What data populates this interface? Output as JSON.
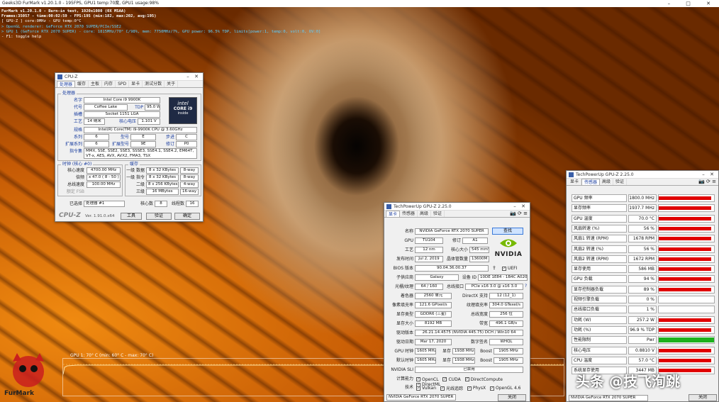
{
  "furmark": {
    "window_title": "Geeks3D FurMark v1.20.1.0 - 195FPS, GPU1 temp:70度, GPU1 usage:98%",
    "osd_lines": [
      "FurMark v1.20.1.0 - Burn-in test, 1920x1080 (0X MSAA)",
      "Frames:35057 - time:00:02:59 - FPS:195 (min:182, max:202, avg:195)",
      "[ GPU-Z ] core:0MHz - GPU temp:0°C",
      "> OpenGL renderer: GeForce RTX 2070 SUPER/PCIe/SSE2",
      "> GPU 1 (GeForce RTX 2070 SUPER) - core: 1815MHz/70° C/98%, mem: 7750MHz/7%, GPU power: 96.5% TDP, limits[power:1, temp:0, volt:0, OV:0]",
      "- F1: toggle help"
    ],
    "graph_label": "GPU 1: 70° C (min: 60° C - max: 70° C)",
    "logo_text": "FurMark"
  },
  "cpuz": {
    "title": "CPU-Z",
    "tabs": [
      "处理器",
      "缓存",
      "主板",
      "内存",
      "SPD",
      "显卡",
      "测试分数",
      "关于"
    ],
    "processor_group": "处理器",
    "labels": {
      "name": "名字",
      "code": "代号",
      "tdp": "TDP",
      "package": "插槽",
      "tech": "工艺",
      "vcore": "核心电压",
      "spec": "规格",
      "family": "系列",
      "model": "型号",
      "stepping": "步进",
      "ext_family": "扩展系列",
      "ext_model": "扩展型号",
      "revision": "修订",
      "instr": "指令集"
    },
    "values": {
      "name": "Intel Core i9 9900K",
      "code": "Coffee Lake",
      "tdp": "95.0 W",
      "package": "Socket 1151 LGA",
      "tech": "14 纳米",
      "vcore": "1.101 V",
      "spec": "Intel(R) Core(TM) i9-9900K CPU @ 3.60GHz",
      "family": "6",
      "model": "E",
      "stepping": "C",
      "ext_family": "6",
      "ext_model": "9E",
      "revision": "P0",
      "instr": "MMX, SSE, SSE2, SSE3, SSSE3, SSE4.1, SSE4.2, EM64T, VT-x, AES, AVX, AVX2, FMA3, TSX"
    },
    "logo": {
      "brand": "intel",
      "line1": "CORE i9",
      "line2": "inside"
    },
    "clocks_group": "时钟 (核心 #0)",
    "clock_labels": [
      "核心速度",
      "倍频",
      "总线速度",
      "额定 FSB"
    ],
    "clock_values": [
      "4700.00 MHz",
      "x 47.0 ( 8 - 50 )",
      "100.00 MHz",
      ""
    ],
    "cache_group": "缓存",
    "cache_rows": [
      [
        "一级 数据",
        "8 x 32 KBytes",
        "8-way"
      ],
      [
        "一级 指令",
        "8 x 32 KBytes",
        "8-way"
      ],
      [
        "二级",
        "8 x 256 KBytes",
        "4-way"
      ],
      [
        "三级",
        "16 MBytes",
        "16-way"
      ]
    ],
    "selected_label": "已选择",
    "selected_value": "处理器 #1",
    "cores_label": "核心数",
    "cores_value": "8",
    "threads_label": "线程数",
    "threads_value": "16",
    "footer_brand": "CPU-Z",
    "version": "Ver. 1.91.0.x64",
    "tools_btn": "工具",
    "validate_btn": "验证",
    "ok_btn": "确定"
  },
  "gpuz": {
    "title": "TechPowerUp GPU-Z 2.25.0",
    "tabs": [
      "显卡",
      "传感器",
      "高级",
      "验证"
    ],
    "lookup_btn": "查找",
    "labels": {
      "name": "名称",
      "gpu": "GPU",
      "rev": "修订",
      "tech": "工艺",
      "die": "核心大小",
      "release": "发布时间",
      "transistors": "晶体管数量",
      "bios": "BIOS 版本",
      "subvendor": "子供应商",
      "device_id": "设备 ID",
      "rops": "光栅/纹理",
      "bus": "总线接口",
      "shaders": "着色器",
      "dx": "DirectX 支持",
      "pixel": "像素填充率",
      "texture": "纹理填充率",
      "memtype": "显存类型",
      "buswidth": "总线宽度",
      "memsize": "显存大小",
      "bandwidth": "带宽",
      "driver": "驱动版本",
      "driverdate": "驱动日期",
      "sig": "数字签名",
      "gpuclock": "GPU 时钟",
      "memory": "显存",
      "boost": "Boost",
      "defclock": "默认时钟",
      "sli": "NVIDIA SLI",
      "compute": "计算能力",
      "tech2": "技术"
    },
    "values": {
      "name": "NVIDIA GeForce RTX 2070 SUPER",
      "gpu": "TU104",
      "rev": "A1",
      "tech": "12 nm",
      "die": "545 mm²",
      "release": "Jul 2, 2019",
      "transistors": "13600M",
      "bios": "90.04.36.00.37",
      "uefi": "UEFI",
      "subvendor": "Galaxy",
      "device_id": "10DE 1E84 - 1B4C A020",
      "rops": "64 / 160",
      "bus": "PCIe x16 3.0 @ x16 3.0",
      "shaders": "2560 单元",
      "dx": "12 (12_1)",
      "pixel": "121.6 GPixel/s",
      "texture": "304.0 GTexel/s",
      "memtype": "GDDR6 (三星)",
      "buswidth": "256 位",
      "memsize": "8192 MB",
      "bandwidth": "496.1 GB/s",
      "driver": "26.21.14.4575 (NVIDIA 445.75) DCH / Win10 64",
      "driverdate": "Mar 17, 2020",
      "sig": "WHQL",
      "gpuclock": "1605 MHz",
      "memory1": "1938 MHz",
      "boost1": "1905 MHz",
      "defclock": "1605 MHz",
      "memory2": "1938 MHz",
      "boost2": "1905 MHz",
      "sli": "已禁用"
    },
    "compute": [
      "OpenCL",
      "CUDA",
      "DirectCompute",
      "DirectML"
    ],
    "tech2": [
      "Vulkan",
      "光线追踪",
      "PhysX",
      "OpenGL 4.6"
    ],
    "footer_select": "NVIDIA GeForce RTX 2070 SUPER",
    "close_btn": "关闭",
    "nvidia": "NVIDIA"
  },
  "gpuz2": {
    "title": "TechPowerUp GPU-Z 2.25.0",
    "tabs": [
      "显卡",
      "传感器",
      "高级",
      "验证"
    ],
    "sensors": [
      {
        "name": "GPU 频率",
        "value": "1800.0 MHz",
        "pct": 0.95,
        "color": "#e00000"
      },
      {
        "name": "显存频率",
        "value": "1937.7 MHz",
        "pct": 0.95,
        "color": "#e00000"
      },
      {
        "name": "GPU 温度",
        "value": "70.0 °C",
        "pct": 0.95,
        "color": "#e00000"
      },
      {
        "name": "风扇转速 (%)",
        "value": "56 %",
        "pct": 0.95,
        "color": "#e00000"
      },
      {
        "name": "风扇1 转速 (RPM)",
        "value": "1678 RPM",
        "pct": 0.95,
        "color": "#e00000"
      },
      {
        "name": "风扇2 转速 (%)",
        "value": "56 %",
        "pct": 0.95,
        "color": "#e00000"
      },
      {
        "name": "风扇2 转速 (RPM)",
        "value": "1672 RPM",
        "pct": 0.95,
        "color": "#e00000"
      },
      {
        "name": "显存使用",
        "value": "586 MB",
        "pct": 0.95,
        "color": "#e00000"
      },
      {
        "name": "GPU 负载",
        "value": "94 %",
        "pct": 0.95,
        "color": "#e00000"
      },
      {
        "name": "显存控制器负载",
        "value": "89 %",
        "pct": 0.95,
        "color": "#e00000"
      },
      {
        "name": "视频引擎负载",
        "value": "0 %",
        "pct": 0,
        "color": "#e00000"
      },
      {
        "name": "总线接口负载",
        "value": "1 %",
        "pct": 0,
        "color": "#e00000"
      },
      {
        "name": "功耗 (W)",
        "value": "257.2 W",
        "pct": 0.95,
        "color": "#e00000"
      },
      {
        "name": "功耗 (%)",
        "value": "96.9 % TDP",
        "pct": 0.95,
        "color": "#e00000"
      },
      {
        "name": "性能限制",
        "value": "Pwr",
        "pct": 1,
        "color": "#1db11d"
      },
      {
        "name": "核心电压",
        "value": "0.8810 V",
        "pct": 0.95,
        "color": "#e00000"
      },
      {
        "name": "CPU 温度",
        "value": "57.0 °C",
        "pct": 0.95,
        "color": "#e00000"
      },
      {
        "name": "系统显存使用",
        "value": "3447 MB",
        "pct": 0.95,
        "color": "#e00000"
      }
    ],
    "footer_select": "NVIDIA GeForce RTX 2070 SUPER",
    "close_btn": "关闭"
  },
  "watermark": "头条 @技飞洵跳"
}
